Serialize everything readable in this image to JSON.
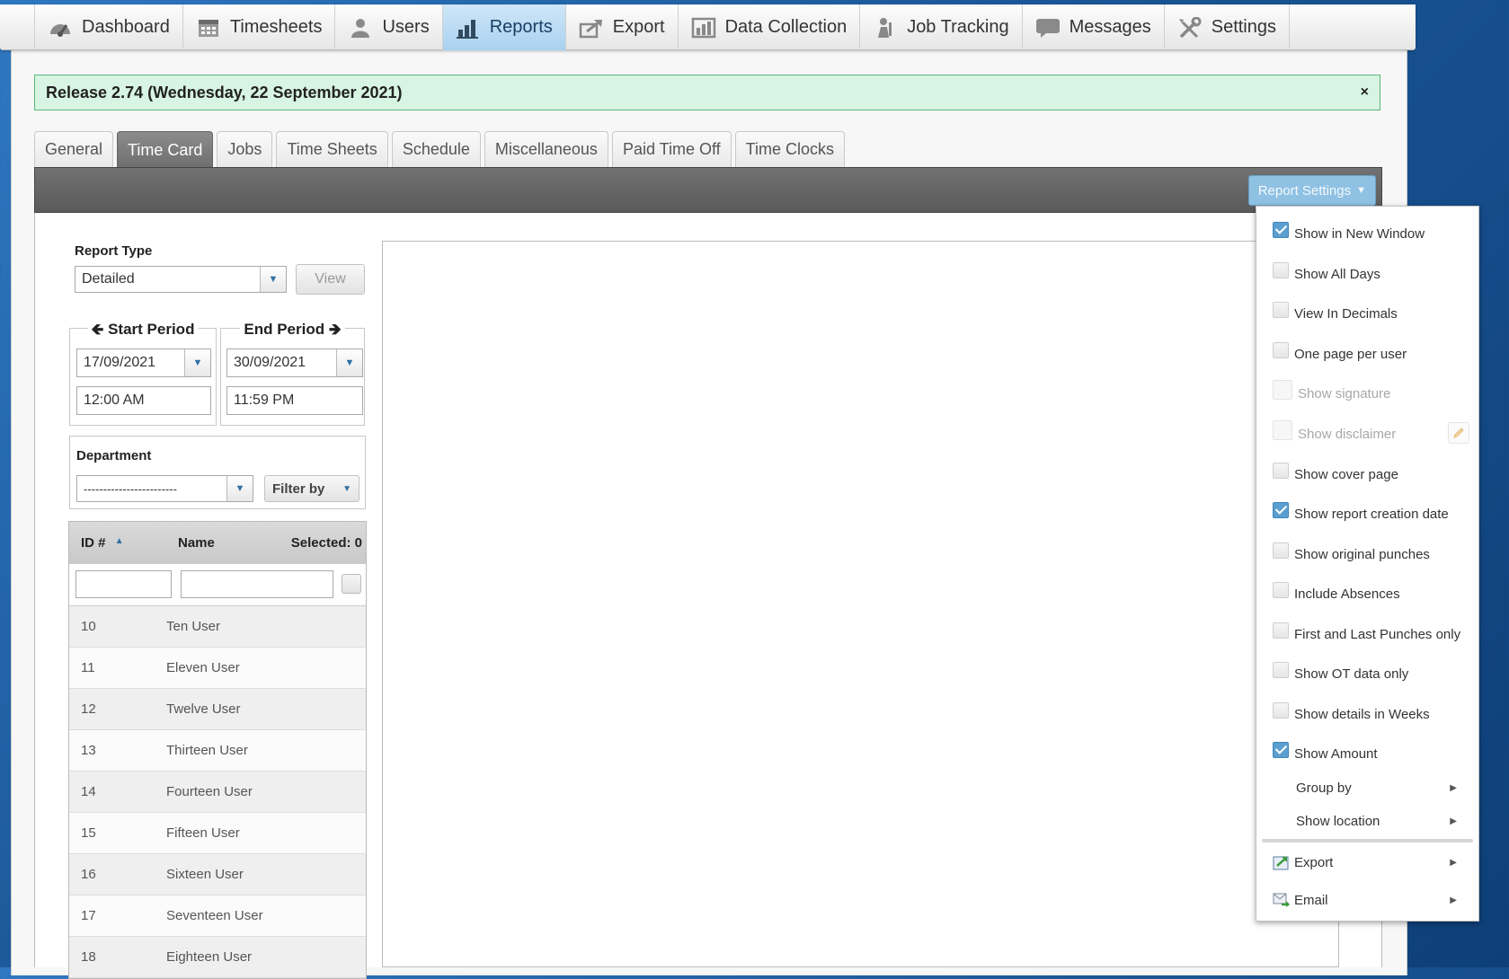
{
  "nav": [
    {
      "label": "Dashboard",
      "icon": "dashboard-icon"
    },
    {
      "label": "Timesheets",
      "icon": "calendar-icon"
    },
    {
      "label": "Users",
      "icon": "user-icon"
    },
    {
      "label": "Reports",
      "icon": "bar-chart-icon",
      "active": true
    },
    {
      "label": "Export",
      "icon": "export-icon"
    },
    {
      "label": "Data Collection",
      "icon": "data-collection-icon"
    },
    {
      "label": "Job Tracking",
      "icon": "job-tracking-icon"
    },
    {
      "label": "Messages",
      "icon": "message-icon"
    },
    {
      "label": "Settings",
      "icon": "tools-icon"
    }
  ],
  "banner": {
    "text": "Release 2.74 (Wednesday, 22 September 2021)",
    "close": "×"
  },
  "tabs": [
    "General",
    "Time Card",
    "Jobs",
    "Time Sheets",
    "Schedule",
    "Miscellaneous",
    "Paid Time Off",
    "Time Clocks"
  ],
  "active_tab": "Time Card",
  "toolbar": {
    "report_settings_label": "Report Settings"
  },
  "report_type": {
    "label": "Report Type",
    "value": "Detailed",
    "view_label": "View"
  },
  "start_period": {
    "label": "Start Period",
    "date": "17/09/2021",
    "time": "12:00 AM"
  },
  "end_period": {
    "label": "End Period",
    "date": "30/09/2021",
    "time": "11:59 PM"
  },
  "department": {
    "label": "Department",
    "value": "------------------------",
    "filter_label": "Filter by"
  },
  "user_table": {
    "headers": {
      "id": "ID #",
      "name": "Name",
      "selected": "Selected: 0"
    },
    "rows": [
      {
        "id": "10",
        "name": "Ten User"
      },
      {
        "id": "11",
        "name": "Eleven User"
      },
      {
        "id": "12",
        "name": "Twelve User"
      },
      {
        "id": "13",
        "name": "Thirteen User"
      },
      {
        "id": "14",
        "name": "Fourteen User"
      },
      {
        "id": "15",
        "name": "Fifteen User"
      },
      {
        "id": "16",
        "name": "Sixteen User"
      },
      {
        "id": "17",
        "name": "Seventeen User"
      },
      {
        "id": "18",
        "name": "Eighteen User"
      }
    ]
  },
  "settings_menu": {
    "options": [
      {
        "label": "Show in New Window",
        "checked": true
      },
      {
        "label": "Show All Days",
        "checked": false
      },
      {
        "label": "View In Decimals",
        "checked": false
      },
      {
        "label": "One page per user",
        "checked": false
      },
      {
        "label": "Show signature",
        "checked": false,
        "disabled": true
      },
      {
        "label": "Show disclaimer",
        "checked": false,
        "disabled": true
      },
      {
        "label": "Show cover page",
        "checked": false
      },
      {
        "label": "Show report creation date",
        "checked": true
      },
      {
        "label": "Show original punches",
        "checked": false
      },
      {
        "label": "Include Absences",
        "checked": false
      },
      {
        "label": "First and Last Punches only",
        "checked": false
      },
      {
        "label": "Show OT data only",
        "checked": false
      },
      {
        "label": "Show details in Weeks",
        "checked": false
      },
      {
        "label": "Show Amount",
        "checked": true
      }
    ],
    "submenus": [
      "Group by",
      "Show location"
    ],
    "actions": [
      {
        "label": "Export",
        "icon": "export-report-icon"
      },
      {
        "label": "Email",
        "icon": "email-icon"
      }
    ]
  }
}
